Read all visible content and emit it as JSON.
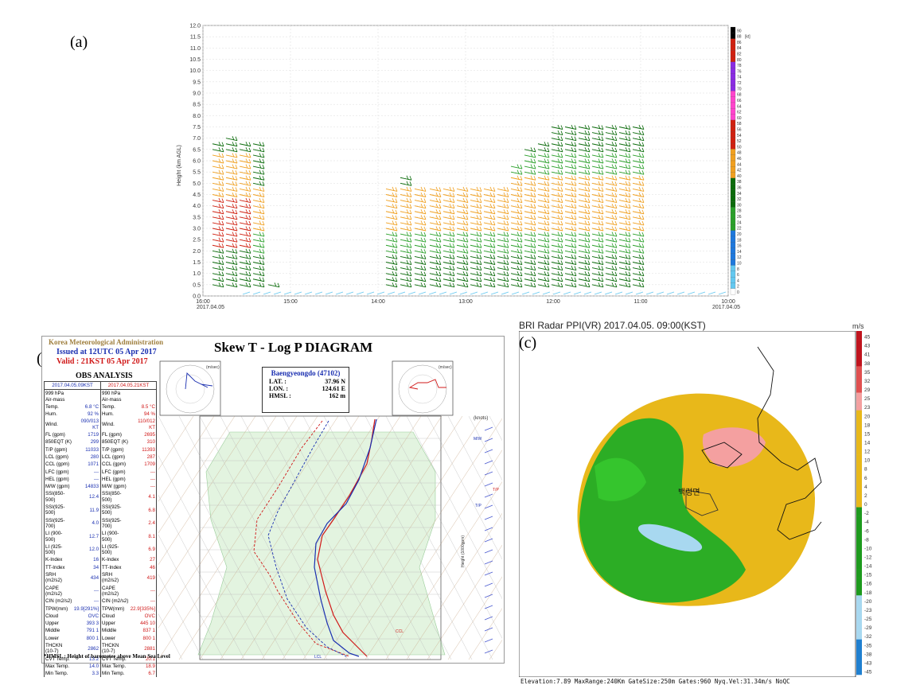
{
  "labels": {
    "a": "(a)",
    "b": "(b)",
    "c": "(c)"
  },
  "panel_a": {
    "ylabel": "Height (km AGL)",
    "yticks": [
      "0.0",
      "0.5",
      "1.0",
      "1.5",
      "2.0",
      "2.5",
      "3.0",
      "3.5",
      "4.0",
      "4.5",
      "5.0",
      "5.5",
      "6.0",
      "6.5",
      "7.0",
      "7.5",
      "8.0",
      "8.5",
      "9.0",
      "9.5",
      "10.0",
      "10.5",
      "11.0",
      "11.5",
      "12.0"
    ],
    "xticks": [
      "16:00",
      "15:00",
      "14:00",
      "13:00",
      "12:00",
      "11:00",
      "10:00"
    ],
    "date_left": "2017.04.05",
    "date_right": "2017.04.05",
    "colorbar_unit": "[kt]",
    "colorbar_ticks": [
      "90",
      "88",
      "86",
      "84",
      "82",
      "80",
      "78",
      "76",
      "74",
      "72",
      "70",
      "68",
      "66",
      "64",
      "62",
      "60",
      "58",
      "56",
      "54",
      "52",
      "50",
      "48",
      "46",
      "44",
      "42",
      "40",
      "38",
      "36",
      "34",
      "32",
      "30",
      "28",
      "26",
      "24",
      "22",
      "20",
      "18",
      "16",
      "14",
      "12",
      "10",
      "8",
      "6",
      "4",
      "2",
      "0"
    ],
    "colors": {
      "dark_green": "#0a6b0a",
      "green": "#2aa02a",
      "orange": "#f0a020",
      "red": "#d02010",
      "blue": "#1e78dc",
      "light_blue": "#64c8f0"
    }
  },
  "panel_b": {
    "org": "Korea Meteorological Administration",
    "issued": "Issued at 12UTC 05 Apr 2017",
    "valid": "Valid :  21KST 05 Apr 2017",
    "title": "Skew T - Log P DIAGRAM",
    "obs": "OBS  ANALYSIS",
    "hodo_unit": "(m/sec)",
    "station": "Baengyeongdo (47102)",
    "lat_label": "LAT.  :",
    "lat": "37.96 N",
    "lon_label": "LON.  :",
    "lon": "124.61 E",
    "hmsl_label": "HMSL :",
    "hmsl": "162 m",
    "knots": "(knots)",
    "height_label": "Height (1000gpm)",
    "footer": "*HMSL : Height of barometer above Mean Sea Level",
    "col1_head": "2017.04.05.09KST",
    "col2_head": "2017.04.05.21KST",
    "rows": [
      [
        "999  hPa Air-mass",
        "",
        "990  hPa Air-mass",
        ""
      ],
      [
        "Temp.",
        "6.8 °C",
        "Temp.",
        "8.5 °C"
      ],
      [
        "Hum.",
        "92  %",
        "Hum.",
        "94  %"
      ],
      [
        "Wind.",
        "090/013 KT",
        "Wind.",
        "110/012 KT"
      ],
      [
        "FL (gpm)",
        "1719",
        "FL (gpm)",
        "2695"
      ],
      [
        "850EQT (K)",
        "299",
        "850EQT (K)",
        "310"
      ],
      [
        "T/P (gpm)",
        "11033",
        "T/P (gpm)",
        "11393"
      ],
      [
        "LCL (gpm)",
        "280",
        "LCL (gpm)",
        "287"
      ],
      [
        "CCL (gpm)",
        "1071",
        "CCL (gpm)",
        "1709"
      ],
      [
        "LFC (gpm)",
        "---",
        "LFC (gpm)",
        "---"
      ],
      [
        "HEL (gpm)",
        "---",
        "HEL (gpm)",
        "---"
      ],
      [
        "M/W (gpm)",
        "14833",
        "M/W (gpm)",
        "---"
      ],
      [
        "SSI(850-500)",
        "12.4",
        "SSI(850-500)",
        "4.1"
      ],
      [
        "SSI(925-500)",
        "11.9",
        "SSI(925-500)",
        "6.8"
      ],
      [
        "SSI(925-700)",
        "4.0",
        "SSI(925-700)",
        "2.4"
      ],
      [
        "LI (900-500)",
        "12.7",
        "LI (900-500)",
        "8.1"
      ],
      [
        "LI (925-500)",
        "12.0",
        "LI (925-500)",
        "6.9"
      ],
      [
        "K-Index",
        "16",
        "K-Index",
        "27"
      ],
      [
        "TT-Index",
        "34",
        "TT-Index",
        "46"
      ],
      [
        "SRH (m2/s2)",
        "434",
        "SRH (m2/s2)",
        "419"
      ],
      [
        "CAPE (m2/s2)",
        "---",
        "CAPE (m2/s2)",
        "---"
      ],
      [
        "CIN (m2/s2)",
        "---",
        "CIN (m2/s2)",
        "---"
      ],
      [
        "TPW(mm)",
        "19.9[291%]",
        "TPW(mm)",
        "22.9[335%]"
      ],
      [
        "Cloud",
        "OVC",
        "Cloud",
        "OVC"
      ],
      [
        "Upper",
        "393   3",
        "Upper",
        "445  10"
      ],
      [
        "Middle",
        "791   1",
        "Middle",
        "837   1"
      ],
      [
        "Lower",
        "800   1",
        "Lower",
        "800   1"
      ],
      [
        "THCKN (10-7)",
        "2862",
        "THCKN (10-7)",
        "2881"
      ],
      [
        "CVT Temp.",
        "13.2",
        "CVT Temp.",
        "20.1"
      ],
      [
        "Max Temp.",
        "14.0",
        "Max Temp.",
        "18.9"
      ],
      [
        "Min Temp.",
        "3.3",
        "Min Temp.",
        "6.7"
      ]
    ],
    "annotations": {
      "tp": "T/P",
      "mw": "M/W",
      "ccl": "CCL",
      "lcl": "LCL"
    }
  },
  "panel_c": {
    "title": "BRI Radar PPI(VR) 2017.04.05. 09:00(KST)",
    "unit": "m/s",
    "place": "백령면",
    "footer": "Elevation:7.89  MaxRange:240Km GateSize:250m Gates:960 Nyq.Vel:31.34m/s NoQC",
    "colorbar_ticks": [
      "45",
      "43",
      "41",
      "38",
      "35",
      "32",
      "29",
      "25",
      "23",
      "20",
      "18",
      "15",
      "14",
      "12",
      "10",
      "8",
      "6",
      "4",
      "2",
      "0",
      "-2",
      "-4",
      "-6",
      "-8",
      "-10",
      "-12",
      "-14",
      "-15",
      "-16",
      "-18",
      "-20",
      "-23",
      "-25",
      "-29",
      "-32",
      "-35",
      "-38",
      "-43",
      "-45"
    ]
  }
}
